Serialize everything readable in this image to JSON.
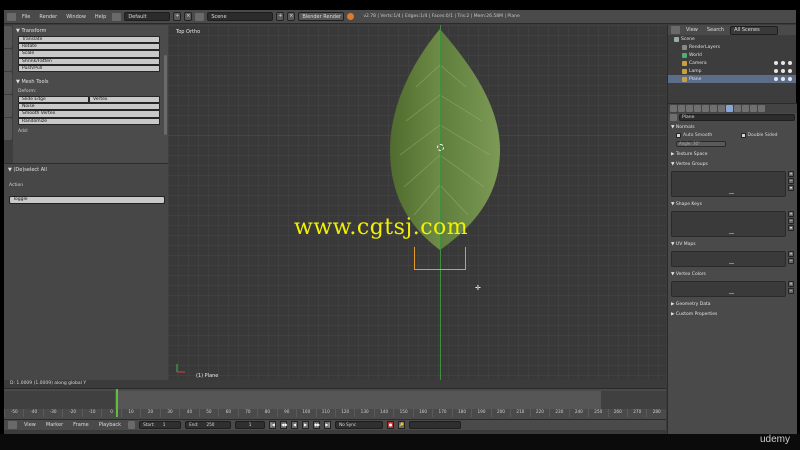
{
  "header": {
    "menus": [
      "File",
      "Render",
      "Window",
      "Help"
    ],
    "layout": "Default",
    "scene": "Scene",
    "engine": "Blender Render",
    "stats": "v2.78 | Verts:1/4 | Edges:1/4 | Faces:0/1 | Tris:2 | Mem:26.58M | Plane"
  },
  "toolshelf": {
    "transform_title": "Transform",
    "transform_buttons": [
      "Translate",
      "Rotate",
      "Scale",
      "Shrink/Fatten",
      "Push/Pull"
    ],
    "mesh_tools_title": "Mesh Tools",
    "deform_label": "Deform:",
    "slide_edge": "Slide Edge",
    "vertex": "Vertex",
    "deform_buttons": [
      "Noise",
      "Smooth Vertex",
      "Randomize"
    ],
    "add_label": "Add:",
    "operator_title": "(De)select All",
    "action_label": "Action",
    "action_value": "Toggle"
  },
  "viewport": {
    "title": "Top Ortho",
    "object_label": "(1) Plane",
    "watermark": "www.cgtsj.com",
    "status": "D: 1.0009 (1.0009) along global Y"
  },
  "timeline": {
    "ticks": [
      "-50",
      "-40",
      "-30",
      "-20",
      "-10",
      "0",
      "10",
      "20",
      "30",
      "40",
      "50",
      "60",
      "70",
      "80",
      "90",
      "100",
      "110",
      "120",
      "130",
      "140",
      "150",
      "160",
      "170",
      "180",
      "190",
      "200",
      "210",
      "220",
      "230",
      "240",
      "250",
      "260",
      "270",
      "280"
    ],
    "menus": [
      "View",
      "Marker",
      "Frame",
      "Playback"
    ],
    "start_label": "Start:",
    "start_value": "1",
    "end_label": "End:",
    "end_value": "250",
    "current_frame": "1",
    "sync": "No Sync"
  },
  "outliner": {
    "view": "View",
    "search": "Search",
    "filter": "All Scenes",
    "items": [
      "Scene",
      "RenderLayers",
      "World",
      "Camera",
      "Lamp",
      "Plane"
    ]
  },
  "properties": {
    "object_name": "Plane",
    "normals_title": "Normals",
    "auto_smooth": "Auto Smooth",
    "double_sided": "Double Sided",
    "angle_label": "Angle:",
    "angle_value": "30°",
    "texture_space": "Texture Space",
    "vertex_groups": "Vertex Groups",
    "shape_keys": "Shape Keys",
    "uv_maps": "UV Maps",
    "vertex_colors": "Vertex Colors",
    "geometry_data": "Geometry Data",
    "custom_properties": "Custom Properties"
  },
  "brand": "udemy",
  "colors": {
    "watermark": "#f2f200",
    "x_axis": "#6b3535",
    "y_axis": "#3f8f3f",
    "selection": "#e89a2c",
    "frame_cursor": "#5fbe3c"
  }
}
